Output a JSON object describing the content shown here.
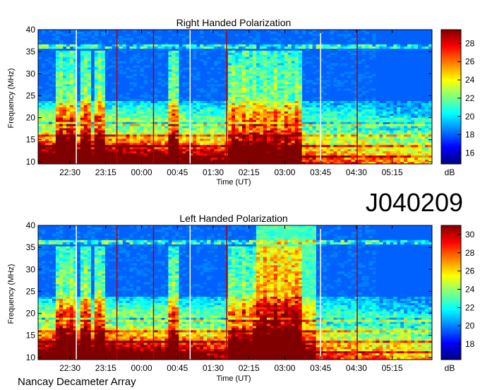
{
  "figure": {
    "observation_id": "J040209",
    "instrument": "Nancay Decameter Array"
  },
  "chart_data": [
    {
      "type": "heatmap",
      "title": "Right Handed Polarization",
      "xlabel": "Time (UT)",
      "ylabel": "Frequency (MHz)",
      "x_tick_labels": [
        "22:30",
        "23:15",
        "00:00",
        "00:45",
        "01:30",
        "02:15",
        "03:00",
        "03:45",
        "04:30",
        "05:15"
      ],
      "x_tick_minutes": [
        1350,
        1395,
        1440,
        1485,
        1530,
        1575,
        1620,
        1665,
        1710,
        1755
      ],
      "xlim_minutes": [
        1310,
        1805
      ],
      "y_ticks": [
        10,
        15,
        20,
        25,
        30,
        35,
        40
      ],
      "ylim": [
        9.5,
        40
      ],
      "colorbar": {
        "unit": "dB",
        "ticks": [
          16,
          18,
          20,
          22,
          24,
          26,
          28
        ],
        "range": [
          14.8,
          29.5
        ],
        "colormap": "jet"
      },
      "markers": [
        {
          "time_minutes": 1358,
          "color": "#ffffff"
        },
        {
          "time_minutes": 1409,
          "color": "#b40000"
        },
        {
          "time_minutes": 1455,
          "color": "#b40000"
        },
        {
          "time_minutes": 1501,
          "color": "#ffffff"
        },
        {
          "time_minutes": 1547,
          "color": "#b40000"
        },
        {
          "time_minutes": 1665,
          "color": "#ffffff"
        },
        {
          "time_minutes": 1711,
          "color": "#b40000"
        }
      ]
    },
    {
      "type": "heatmap",
      "title": "Left Handed Polarization",
      "xlabel": "Time (UT)",
      "ylabel": "Frequency (MHz)",
      "x_tick_labels": [
        "22:30",
        "23:15",
        "00:00",
        "00:45",
        "01:30",
        "02:15",
        "03:00",
        "03:45",
        "04:30",
        "05:15"
      ],
      "x_tick_minutes": [
        1350,
        1395,
        1440,
        1485,
        1530,
        1575,
        1620,
        1665,
        1710,
        1755
      ],
      "xlim_minutes": [
        1310,
        1805
      ],
      "y_ticks": [
        10,
        15,
        20,
        25,
        30,
        35,
        40
      ],
      "ylim": [
        9.5,
        40
      ],
      "colorbar": {
        "unit": "dB",
        "ticks": [
          18,
          20,
          22,
          24,
          26,
          28,
          30
        ],
        "range": [
          16.3,
          31
        ],
        "colormap": "jet"
      },
      "markers": [
        {
          "time_minutes": 1358,
          "color": "#ffffff"
        },
        {
          "time_minutes": 1409,
          "color": "#b40000"
        },
        {
          "time_minutes": 1455,
          "color": "#b40000"
        },
        {
          "time_minutes": 1501,
          "color": "#ffffff"
        },
        {
          "time_minutes": 1547,
          "color": "#b40000"
        },
        {
          "time_minutes": 1665,
          "color": "#ffffff"
        },
        {
          "time_minutes": 1711,
          "color": "#b40000"
        }
      ]
    }
  ]
}
